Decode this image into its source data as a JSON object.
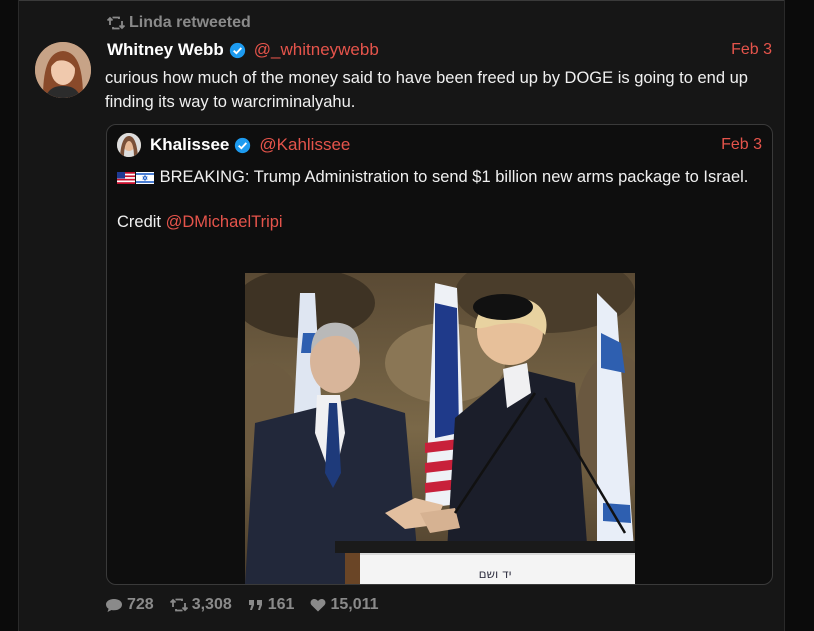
{
  "retweet": {
    "label": "Linda retweeted"
  },
  "tweet": {
    "author_name": "Whitney Webb",
    "author_handle": "@_whitneywebb",
    "date": "Feb 3",
    "text": "curious how much of the money said to have been freed up by DOGE is going to end up finding its way to warcriminalyahu."
  },
  "quote": {
    "author_name": "Khalissee",
    "author_handle": "@Kahlissee",
    "date": "Feb 3",
    "text": "BREAKING: Trump Administration to send $1 billion new arms package to Israel.",
    "credit_label": "Credit",
    "credit_link": "@DMichaelTripi",
    "podium_text": "יד ושם"
  },
  "stats": {
    "replies": "728",
    "retweets": "3,308",
    "quotes": "161",
    "likes": "15,011"
  },
  "icons": {
    "retweet": "retweet-icon",
    "verified": "verified-badge-icon",
    "reply": "reply-icon",
    "quote": "quote-icon",
    "like": "heart-icon"
  },
  "colors": {
    "accent": "#e5544b",
    "muted": "#8a8a8a",
    "verified": "#1d9bf0"
  }
}
